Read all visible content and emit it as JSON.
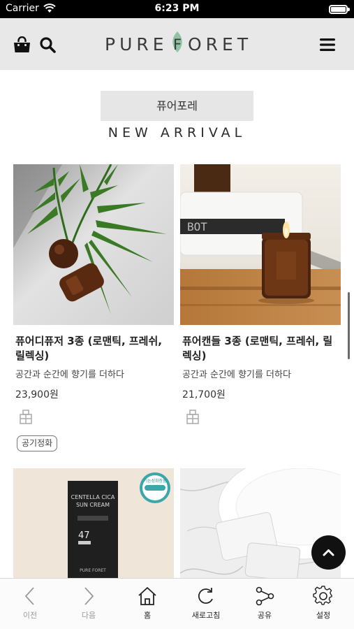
{
  "status_bar": {
    "carrier": "Carrier",
    "time": "6:23 PM"
  },
  "header": {
    "logo_left": "PURE",
    "logo_right": "ORET",
    "logo_leaf": "F"
  },
  "section": {
    "brand_label": "퓨어포레",
    "heading": "NEW ARRIVAL"
  },
  "products": [
    {
      "title": "퓨어디퓨저 3종 (로맨틱, 프레쉬, 릴렉싱)",
      "description": "공간과 순간에 향기를 더하다",
      "price": "23,900원",
      "tag": "공기정화"
    },
    {
      "title": "퓨어캔들 3종 (로맨틱, 프레쉬, 릴렉싱)",
      "description": "공간과 순간에 향기를 더하다",
      "price": "21,700원"
    },
    {
      "image_text": {
        "line1": "CENTELLA CICA",
        "line2": "SUN CREAM",
        "spf": "47",
        "brand": "PURE FORET",
        "badge": "기능성화장품"
      }
    },
    {}
  ],
  "toolbar": {
    "back": "이전",
    "forward": "다음",
    "home": "홈",
    "refresh": "새로고침",
    "share": "공유",
    "settings": "설정"
  },
  "colors": {
    "header_bg": "#e8e8e8",
    "logo_leaf": "#8fc3a4",
    "top_button": "#111111"
  }
}
